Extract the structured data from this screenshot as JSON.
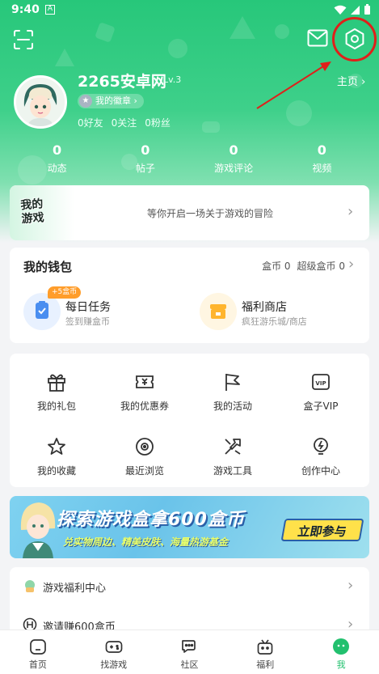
{
  "status_bar": {
    "time": "9:40",
    "notification_glyph": "A"
  },
  "header": {
    "scan_icon": "scan-icon",
    "mail_icon": "mail-icon",
    "settings_icon": "settings-hexagon-icon"
  },
  "profile": {
    "username": "2265安卓网",
    "level": "Lv.3",
    "homepage_label": "主页",
    "badge_label": "我的徽章",
    "friends": "0好友",
    "following": "0关注",
    "fans": "0粉丝"
  },
  "stats": [
    {
      "value": "0",
      "label": "动态"
    },
    {
      "value": "0",
      "label": "帖子"
    },
    {
      "value": "0",
      "label": "游戏评论"
    },
    {
      "value": "0",
      "label": "视频"
    }
  ],
  "my_games": {
    "logo_text": "我的游戏",
    "tagline": "等你开启一场关于游戏的冒险"
  },
  "wallet": {
    "title": "我的钱包",
    "coins": "盒币 0",
    "super_coins": "超级盒币 0",
    "items": [
      {
        "name": "每日任务",
        "sub": "签到赚盒币",
        "tag": "+5盒币",
        "color": "#4a8ef0"
      },
      {
        "name": "福利商店",
        "sub": "疯狂游乐城/商店",
        "color": "#ffb52e"
      }
    ]
  },
  "grid": [
    {
      "label": "我的礼包",
      "icon": "gift-icon"
    },
    {
      "label": "我的优惠券",
      "icon": "coupon-icon"
    },
    {
      "label": "我的活动",
      "icon": "flag-icon"
    },
    {
      "label": "盒子VIP",
      "icon": "vip-icon"
    },
    {
      "label": "我的收藏",
      "icon": "star-icon"
    },
    {
      "label": "最近浏览",
      "icon": "eye-icon"
    },
    {
      "label": "游戏工具",
      "icon": "tools-icon"
    },
    {
      "label": "创作中心",
      "icon": "bulb-icon"
    }
  ],
  "banner": {
    "title": "探索游戏盒拿600盒币",
    "subtitle": "兑实物周边、精美皮肤、海量热游基金",
    "button": "立即参与"
  },
  "list": [
    {
      "label": "游戏福利中心",
      "icon": "welfare-icon"
    },
    {
      "label": "邀请赚600盒币",
      "icon": "invite-icon"
    }
  ],
  "tabbar": [
    {
      "label": "首页",
      "icon": "home-icon"
    },
    {
      "label": "找游戏",
      "icon": "gamepad-icon"
    },
    {
      "label": "社区",
      "icon": "chat-icon"
    },
    {
      "label": "福利",
      "icon": "gift-box-icon"
    },
    {
      "label": "我",
      "icon": "me-icon",
      "active": true
    }
  ],
  "colors": {
    "brand": "#22c06e",
    "highlight": "#e0201a"
  }
}
